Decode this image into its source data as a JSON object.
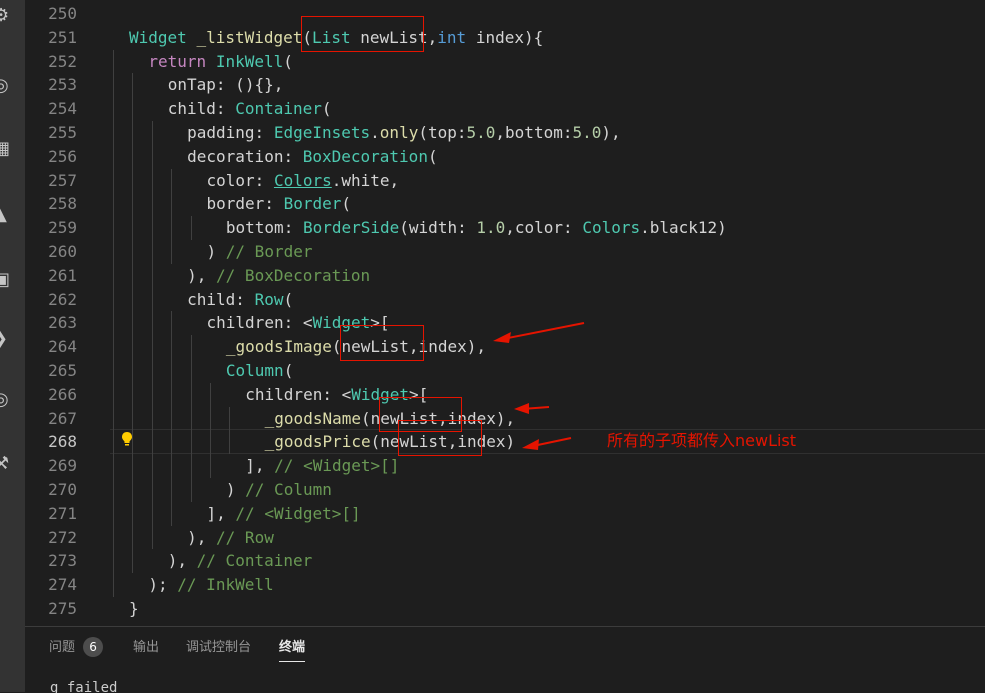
{
  "activity_bar": {
    "icons": [
      "explorer-icon",
      "search-icon",
      "source-control-icon",
      "debug-icon",
      "extensions-icon",
      "remote-icon",
      "accounts-icon",
      "tools-icon"
    ]
  },
  "editor": {
    "active_line": "268",
    "lines": [
      {
        "n": "250",
        "tokens": []
      },
      {
        "n": "251",
        "tokens": [
          {
            "t": "Widget",
            "c": "ty"
          },
          {
            "t": " "
          },
          {
            "t": "_listWidget",
            "c": "fn"
          },
          {
            "t": "("
          },
          {
            "t": "List",
            "c": "ty"
          },
          {
            "t": " newList,"
          },
          {
            "t": "int",
            "c": "bl"
          },
          {
            "t": " index){"
          }
        ]
      },
      {
        "n": "252",
        "tokens": [
          {
            "t": "return",
            "c": "kw"
          },
          {
            "t": " "
          },
          {
            "t": "InkWell",
            "c": "ty"
          },
          {
            "t": "("
          }
        ]
      },
      {
        "n": "253",
        "tokens": [
          {
            "t": "onTap: (){},"
          }
        ]
      },
      {
        "n": "254",
        "tokens": [
          {
            "t": "child: "
          },
          {
            "t": "Container",
            "c": "ty"
          },
          {
            "t": "("
          }
        ]
      },
      {
        "n": "255",
        "tokens": [
          {
            "t": "padding: "
          },
          {
            "t": "EdgeInsets",
            "c": "ty"
          },
          {
            "t": "."
          },
          {
            "t": "only",
            "c": "fn"
          },
          {
            "t": "(top:"
          },
          {
            "t": "5.0",
            "c": "num"
          },
          {
            "t": ",bottom:"
          },
          {
            "t": "5.0",
            "c": "num"
          },
          {
            "t": "),"
          }
        ]
      },
      {
        "n": "256",
        "tokens": [
          {
            "t": "decoration: "
          },
          {
            "t": "BoxDecoration",
            "c": "ty"
          },
          {
            "t": "("
          }
        ]
      },
      {
        "n": "257",
        "tokens": [
          {
            "t": "color: "
          },
          {
            "t": "Colors",
            "c": "lk"
          },
          {
            "t": ".white,"
          }
        ]
      },
      {
        "n": "258",
        "tokens": [
          {
            "t": "border: "
          },
          {
            "t": "Border",
            "c": "ty"
          },
          {
            "t": "("
          }
        ]
      },
      {
        "n": "259",
        "tokens": [
          {
            "t": "bottom: "
          },
          {
            "t": "BorderSide",
            "c": "ty"
          },
          {
            "t": "(width: "
          },
          {
            "t": "1.0",
            "c": "num"
          },
          {
            "t": ",color: "
          },
          {
            "t": "Colors",
            "c": "ty"
          },
          {
            "t": ".black12)"
          }
        ]
      },
      {
        "n": "260",
        "tokens": [
          {
            "t": ") "
          },
          {
            "t": "// Border",
            "c": "cm"
          }
        ]
      },
      {
        "n": "261",
        "tokens": [
          {
            "t": "), "
          },
          {
            "t": "// BoxDecoration",
            "c": "cm"
          }
        ]
      },
      {
        "n": "262",
        "tokens": [
          {
            "t": "child: "
          },
          {
            "t": "Row",
            "c": "ty"
          },
          {
            "t": "("
          }
        ]
      },
      {
        "n": "263",
        "tokens": [
          {
            "t": "children: <"
          },
          {
            "t": "Widget",
            "c": "ty"
          },
          {
            "t": ">["
          }
        ]
      },
      {
        "n": "264",
        "tokens": [
          {
            "t": "_goodsImage",
            "c": "fn"
          },
          {
            "t": "(newList,index),"
          }
        ]
      },
      {
        "n": "265",
        "tokens": [
          {
            "t": "Column",
            "c": "ty"
          },
          {
            "t": "("
          }
        ]
      },
      {
        "n": "266",
        "tokens": [
          {
            "t": "children: <"
          },
          {
            "t": "Widget",
            "c": "ty"
          },
          {
            "t": ">["
          }
        ]
      },
      {
        "n": "267",
        "tokens": [
          {
            "t": "_goodsName",
            "c": "fn"
          },
          {
            "t": "(newList,index),"
          }
        ]
      },
      {
        "n": "268",
        "tokens": [
          {
            "t": "_goodsPrice",
            "c": "fn"
          },
          {
            "t": "(newList,index)"
          }
        ]
      },
      {
        "n": "269",
        "tokens": [
          {
            "t": "], "
          },
          {
            "t": "// <Widget>[]",
            "c": "cm"
          }
        ]
      },
      {
        "n": "270",
        "tokens": [
          {
            "t": ") "
          },
          {
            "t": "// Column",
            "c": "cm"
          }
        ]
      },
      {
        "n": "271",
        "tokens": [
          {
            "t": "], "
          },
          {
            "t": "// <Widget>[]",
            "c": "cm"
          }
        ]
      },
      {
        "n": "272",
        "tokens": [
          {
            "t": "), "
          },
          {
            "t": "// Row",
            "c": "cm"
          }
        ]
      },
      {
        "n": "273",
        "tokens": [
          {
            "t": "), "
          },
          {
            "t": "// Container",
            "c": "cm"
          }
        ]
      },
      {
        "n": "274",
        "tokens": [
          {
            "t": "); "
          },
          {
            "t": "// InkWell",
            "c": "cm"
          }
        ]
      },
      {
        "n": "275",
        "tokens": [
          {
            "t": "}"
          }
        ]
      }
    ],
    "annotation_text": "所有的子项都传入newList"
  },
  "panel": {
    "tabs": [
      {
        "label": "问题",
        "badge": "6",
        "active": false
      },
      {
        "label": "输出",
        "active": false
      },
      {
        "label": "调试控制台",
        "active": false
      },
      {
        "label": "终端",
        "active": true
      }
    ],
    "terminal_text": "g failed"
  },
  "colors": {
    "background": "#1e1e1e",
    "activity_bar": "#333333",
    "annotation": "#e51400",
    "type": "#4ec9b0",
    "keyword": "#c586c0",
    "function": "#dcdcaa",
    "number": "#b5cea8",
    "comment": "#6a9955"
  }
}
